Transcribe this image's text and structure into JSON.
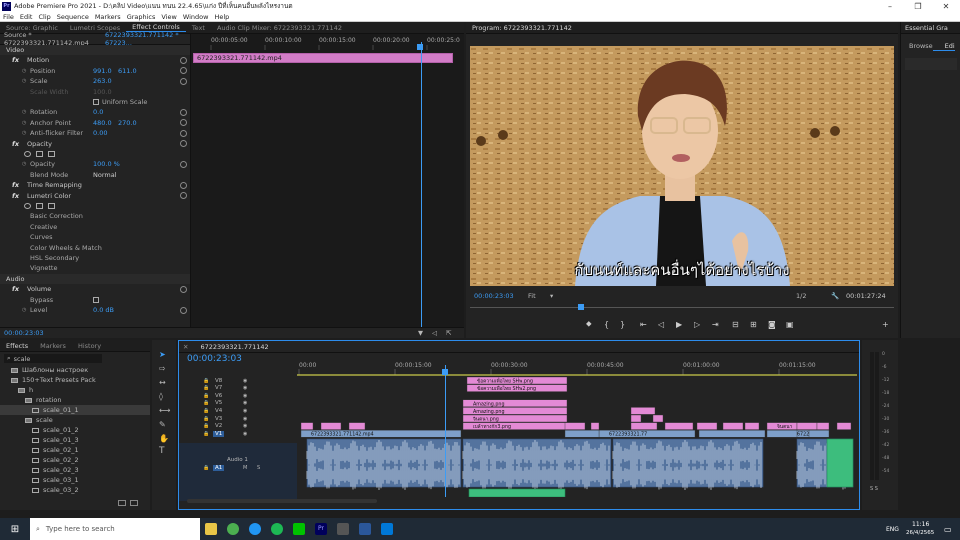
{
  "app": {
    "title": "Adobe Premiere Pro 2021 - D:\\คลิป Video\\แนน ทนน 22.4.65\\แก่ง ปีที่เห็นคนอื่นพลังไหรงานต",
    "menu": [
      "File",
      "Edit",
      "Clip",
      "Sequence",
      "Markers",
      "Graphics",
      "View",
      "Window",
      "Help"
    ]
  },
  "source_panel": {
    "tabs": [
      "Source: Graphic",
      "Lumetri Scopes",
      "Effect Controls",
      "Text",
      "Audio Clip Mixer: 6722393321.771142"
    ],
    "active_tab": "Effect Controls",
    "header_source": "Source * 6722393321.771142.mp4",
    "header_seq": "6722393321.771142 * 67223...",
    "ruler": [
      "00:00:05:00",
      "00:00:10:00",
      "00:00:15:00",
      "00:00:20:00",
      "00:00:25:0"
    ],
    "clip_label": "6722393321.771142.mp4",
    "timecode": "00:00:23:03",
    "rows": [
      {
        "label": "Video",
        "kind": "head"
      },
      {
        "label": "Motion",
        "kind": "fx"
      },
      {
        "label": "Position",
        "v1": "991.0",
        "v2": "611.0",
        "kind": "prop"
      },
      {
        "label": "Scale",
        "v1": "263.0",
        "kind": "prop"
      },
      {
        "label": "Scale Width",
        "v1": "100.0",
        "kind": "dim"
      },
      {
        "label": "Uniform Scale",
        "kind": "check"
      },
      {
        "label": "Rotation",
        "v1": "0.0",
        "kind": "prop"
      },
      {
        "label": "Anchor Point",
        "v1": "480.0",
        "v2": "270.0",
        "kind": "prop"
      },
      {
        "label": "Anti-flicker Filter",
        "v1": "0.00",
        "kind": "prop"
      },
      {
        "label": "Opacity",
        "kind": "fx"
      },
      {
        "label": "",
        "kind": "shapes"
      },
      {
        "label": "Opacity",
        "v1": "100.0 %",
        "kind": "prop"
      },
      {
        "label": "Blend Mode",
        "v1": "Normal",
        "kind": "select"
      },
      {
        "label": "Time Remapping",
        "kind": "fx"
      },
      {
        "label": "Lumetri Color",
        "kind": "fx"
      },
      {
        "label": "",
        "kind": "shapes"
      },
      {
        "label": "Basic Correction",
        "kind": "sub"
      },
      {
        "label": "Creative",
        "kind": "sub"
      },
      {
        "label": "Curves",
        "kind": "sub"
      },
      {
        "label": "Color Wheels & Match",
        "kind": "sub"
      },
      {
        "label": "HSL Secondary",
        "kind": "sub"
      },
      {
        "label": "Vignette",
        "kind": "sub"
      },
      {
        "label": "Audio",
        "kind": "head"
      },
      {
        "label": "Volume",
        "kind": "fx"
      },
      {
        "label": "Bypass",
        "kind": "check"
      },
      {
        "label": "Level",
        "v1": "0.0 dB",
        "kind": "prop"
      }
    ]
  },
  "program": {
    "title": "Program: 6722393321.771142",
    "subtitle": "กับนนท์และคนอื่นๆได้อย่างไรบ้าง",
    "timecode": "00:00:23:03",
    "fit": "Fit",
    "quality": "1/2",
    "duration": "00:01:27:24"
  },
  "essential": {
    "title": "Essential Gra",
    "tabs": [
      "Browse",
      "Edi"
    ]
  },
  "effects_panel": {
    "tabs": [
      "Effects",
      "Markers",
      "History"
    ],
    "search": "scale",
    "tree": [
      {
        "label": "Шаблоны настроек",
        "depth": 1
      },
      {
        "label": "150+Text Presets Pack",
        "depth": 1
      },
      {
        "label": "h",
        "depth": 2
      },
      {
        "label": "rotation",
        "depth": 3
      },
      {
        "label": "scale_01_1",
        "depth": 4,
        "selected": true
      },
      {
        "label": "scale",
        "depth": 3
      },
      {
        "label": "scale_01_2",
        "depth": 4
      },
      {
        "label": "scale_01_3",
        "depth": 4
      },
      {
        "label": "scale_02_1",
        "depth": 4
      },
      {
        "label": "scale_02_2",
        "depth": 4
      },
      {
        "label": "scale_02_3",
        "depth": 4
      },
      {
        "label": "scale_03_1",
        "depth": 4
      },
      {
        "label": "scale_03_2",
        "depth": 4
      }
    ]
  },
  "timeline": {
    "tab": "6722393321.771142",
    "timecode": "00:00:23:03",
    "ruler": [
      "00:00",
      "00:00:15:00",
      "00:00:30:00",
      "00:00:45:00",
      "00:01:00:00",
      "00:01:15:00"
    ],
    "tracks": [
      "V8",
      "V7",
      "V6",
      "V5",
      "V4",
      "V3",
      "V2",
      "V1",
      "A1"
    ],
    "audio_label": "Audio 1",
    "clips": [
      {
        "text": "ข้อความเพื่อไทย SH่พ.png",
        "track": "V8"
      },
      {
        "text": "ข้อความเพื่อไทย SH่พ2.png",
        "track": "V7"
      },
      {
        "text": "Amazing.png",
        "track": "V5"
      },
      {
        "text": "Amazing.png",
        "track": "V4"
      },
      {
        "text": "จินตนา.png",
        "track": "V3"
      },
      {
        "text": "เบล้าทางกัก3.png",
        "track": "V2"
      },
      {
        "text": "6722393321.771142.mp4",
        "track": "V1"
      },
      {
        "text": "6722393321.77",
        "track": "V1"
      },
      {
        "text": "6722393321",
        "track": "V1"
      },
      {
        "text": "จินตนา",
        "track": "V2"
      },
      {
        "text": "เปล้าน",
        "track": "V1"
      }
    ],
    "meter_ticks": [
      "0",
      "-6",
      "-12",
      "-18",
      "-24",
      "-30",
      "-36",
      "-42",
      "-48",
      "-54"
    ],
    "meter_footer": "S S"
  },
  "taskbar": {
    "search": "Type here to search",
    "lang": "ENG",
    "time": "11:16",
    "date": "26/4/2565"
  },
  "colors": {
    "accent": "#2d8ceb",
    "clip_pink": "#e38ad5",
    "clip_blue": "#7e9fc9",
    "clip_green": "#3dbd7d",
    "playhead": "#3c9cf5"
  }
}
